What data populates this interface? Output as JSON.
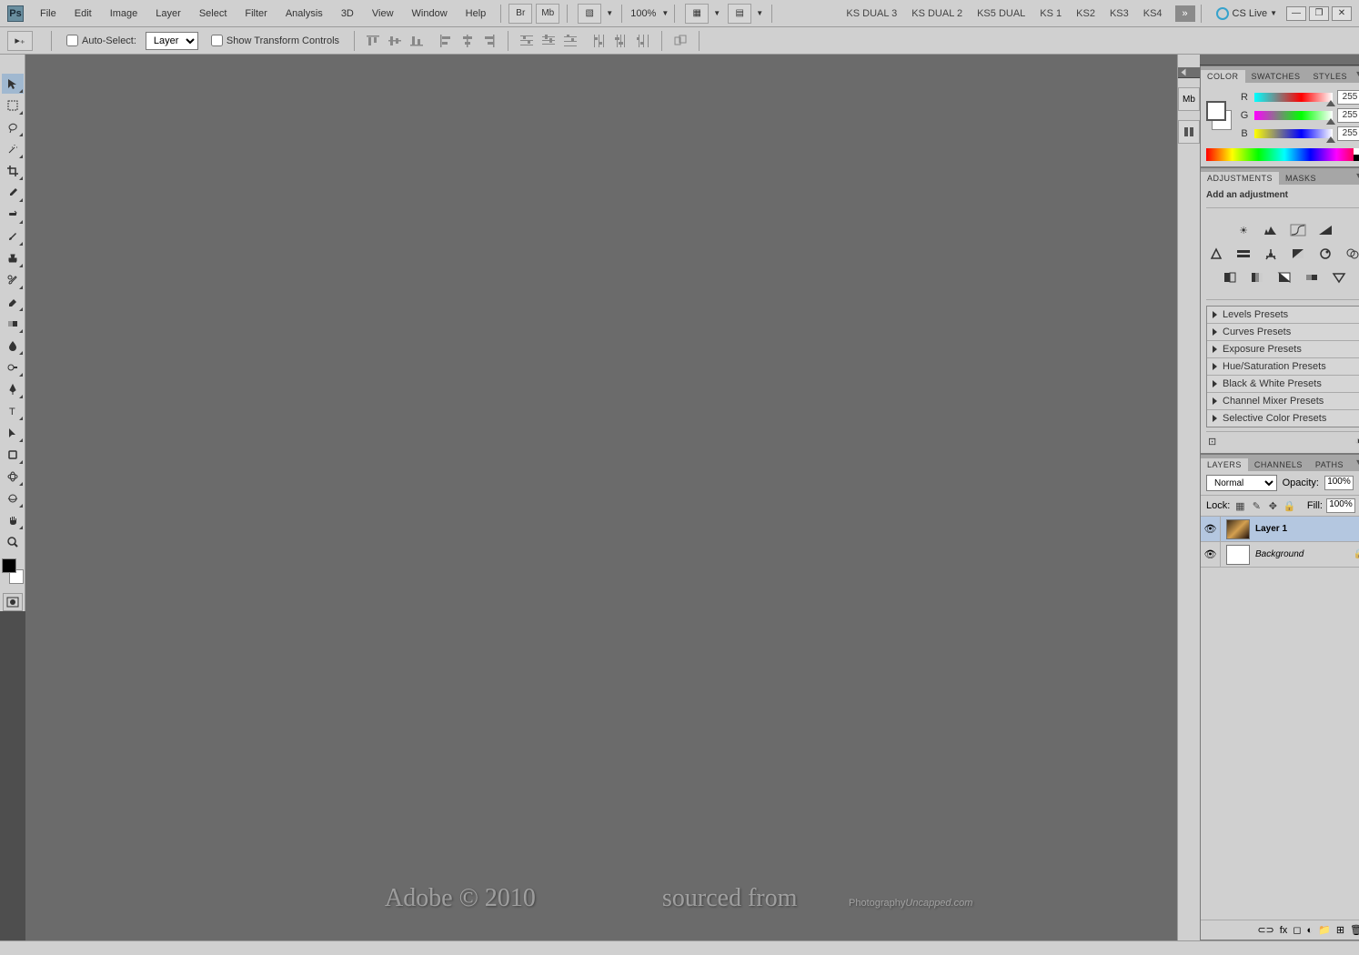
{
  "menu": {
    "items": [
      "File",
      "Edit",
      "Image",
      "Layer",
      "Select",
      "Filter",
      "Analysis",
      "3D",
      "View",
      "Window",
      "Help"
    ]
  },
  "topbar": {
    "zoom": "100%",
    "workspaces": [
      "KS DUAL 3",
      "KS DUAL 2",
      "KS5 DUAL",
      "KS 1",
      "KS2",
      "KS3",
      "KS4"
    ],
    "cslive": "CS Live"
  },
  "options": {
    "autoselect": "Auto-Select:",
    "autoselect_mode": "Layer",
    "transform": "Show Transform Controls"
  },
  "color_panel": {
    "tabs": [
      "COLOR",
      "SWATCHES",
      "STYLES"
    ],
    "channels": [
      {
        "label": "R",
        "value": "255"
      },
      {
        "label": "G",
        "value": "255"
      },
      {
        "label": "B",
        "value": "255"
      }
    ]
  },
  "adjustments_panel": {
    "tabs": [
      "ADJUSTMENTS",
      "MASKS"
    ],
    "title": "Add an adjustment",
    "presets": [
      "Levels Presets",
      "Curves Presets",
      "Exposure Presets",
      "Hue/Saturation Presets",
      "Black & White Presets",
      "Channel Mixer Presets",
      "Selective Color Presets"
    ]
  },
  "layers_panel": {
    "tabs": [
      "LAYERS",
      "CHANNELS",
      "PATHS"
    ],
    "blend": "Normal",
    "opacity_label": "Opacity:",
    "opacity": "100%",
    "lock_label": "Lock:",
    "fill_label": "Fill:",
    "fill": "100%",
    "layers": [
      {
        "name": "Layer 1",
        "bold": true,
        "thumb": "img",
        "locked": false
      },
      {
        "name": "Background",
        "italic": true,
        "thumb": "white",
        "locked": true
      }
    ]
  },
  "watermarks": {
    "left": "Adobe © 2010",
    "mid": "sourced from",
    "right_a": "Photography",
    "right_b": "Uncapped.com"
  }
}
